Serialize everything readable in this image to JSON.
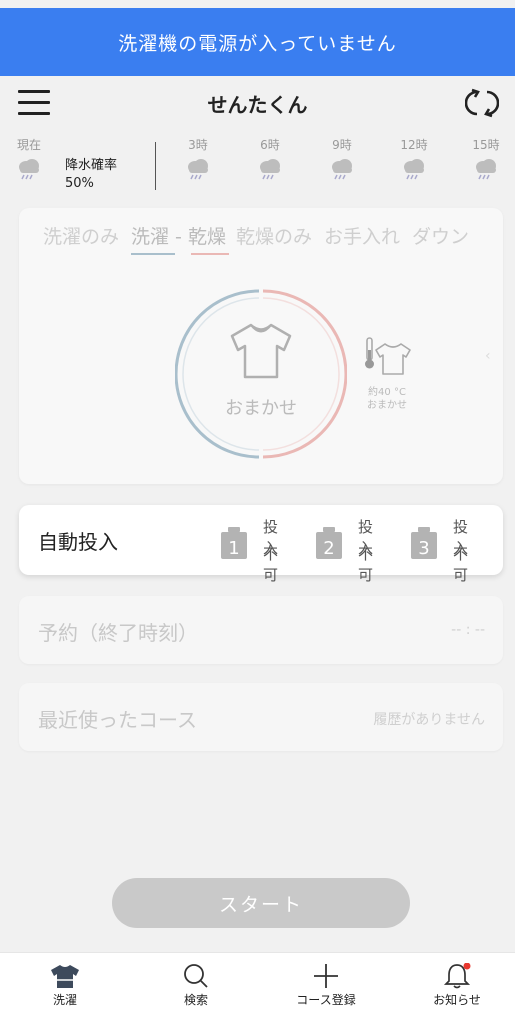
{
  "banner": {
    "text": "洗濯機の電源が入っていません",
    "color": "#3a7ef0"
  },
  "header": {
    "title": "せんたくん",
    "menu_icon": "hamburger-menu-icon",
    "refresh_icon": "refresh-icon"
  },
  "weather": {
    "now_label": "現在",
    "rain_label": "降水確率",
    "rain_value": "50%",
    "forecast": [
      {
        "time": "3時",
        "icon": "rain-cloud-icon"
      },
      {
        "time": "6時",
        "icon": "rain-cloud-icon"
      },
      {
        "time": "9時",
        "icon": "rain-cloud-icon"
      },
      {
        "time": "12時",
        "icon": "rain-cloud-icon"
      },
      {
        "time": "15時",
        "icon": "rain-cloud-icon"
      }
    ]
  },
  "modes": {
    "tabs": [
      "洗濯のみ",
      "洗濯 - 乾燥",
      "乾燥のみ",
      "お手入れ",
      "ダウン"
    ],
    "active_tab": "洗濯 - 乾燥",
    "selected_course": "おまかせ",
    "side_course_line1": "約40 °C",
    "side_course_line2": "おまかせ"
  },
  "auto_dispense": {
    "title": "自動投入",
    "slots": [
      {
        "number": "1",
        "line1": "投入",
        "line2": "不可"
      },
      {
        "number": "2",
        "line1": "投入",
        "line2": "不可"
      },
      {
        "number": "3",
        "line1": "投入",
        "line2": "不可"
      }
    ]
  },
  "reservation": {
    "title": "予約（終了時刻）",
    "value": "-- : --"
  },
  "recent": {
    "title": "最近使ったコース",
    "value": "履歴がありません"
  },
  "start_button": "スタート",
  "nav": [
    {
      "label": "洗濯",
      "icon": "shirt-icon"
    },
    {
      "label": "検索",
      "icon": "search-icon"
    },
    {
      "label": "コース登録",
      "icon": "plus-icon"
    },
    {
      "label": "お知らせ",
      "icon": "bell-icon"
    }
  ],
  "colors": {
    "accent": "#3a7ef0",
    "notification_dot": "#e8382f",
    "wash_ring": "#a9bfcc",
    "dry_ring": "#eab8b5"
  }
}
